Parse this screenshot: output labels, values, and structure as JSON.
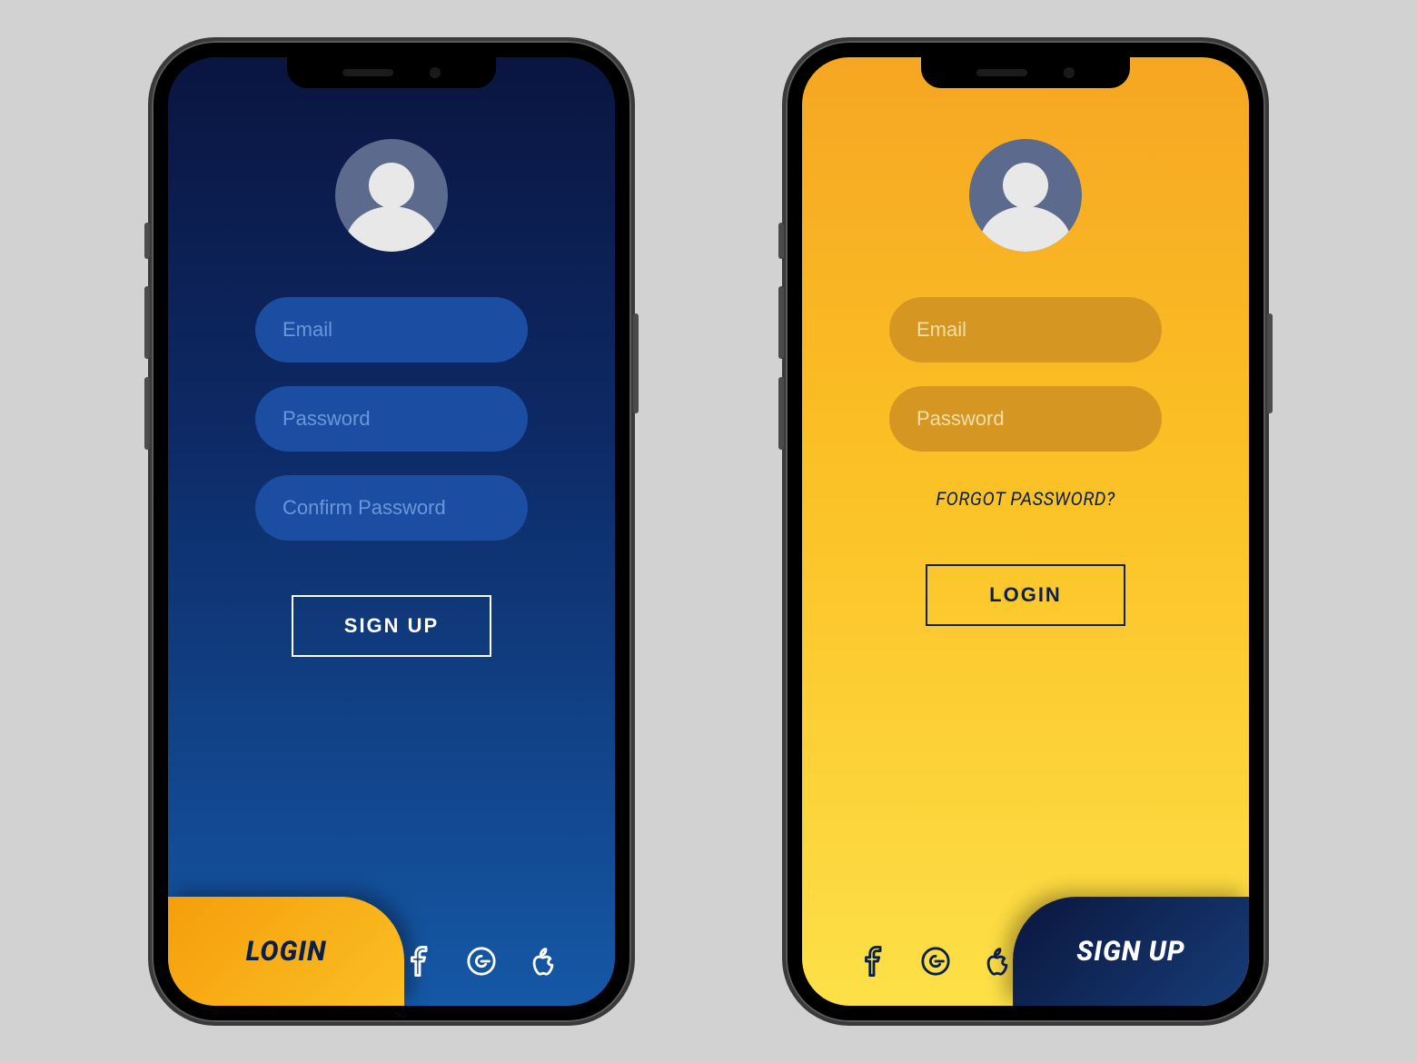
{
  "signup": {
    "fields": {
      "email_placeholder": "Email",
      "password_placeholder": "Password",
      "confirm_placeholder": "Confirm Password"
    },
    "submit_label": "SIGN UP",
    "switch_tab_label": "LOGIN",
    "social": [
      "facebook",
      "google",
      "apple"
    ]
  },
  "login": {
    "fields": {
      "email_placeholder": "Email",
      "password_placeholder": "Password"
    },
    "forgot_label": "FORGOT PASSWORD?",
    "submit_label": "LOGIN",
    "switch_tab_label": "SIGN UP",
    "social": [
      "facebook",
      "google",
      "apple"
    ]
  },
  "colors": {
    "signup_bg_top": "#0a1540",
    "signup_bg_bottom": "#1558a6",
    "login_bg_top": "#f6a623",
    "login_bg_bottom": "#fde047",
    "signup_input": "#1b4ea3",
    "login_input": "#d59722"
  }
}
